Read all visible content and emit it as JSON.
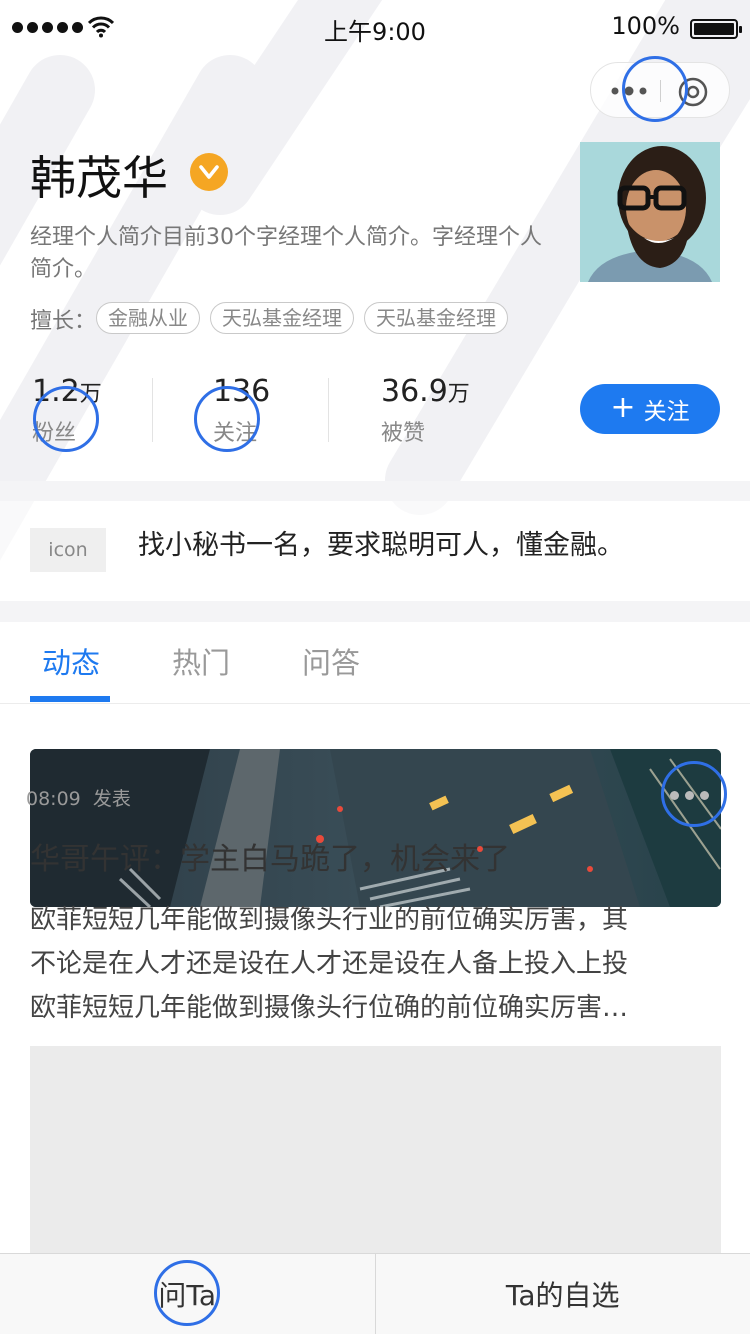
{
  "status_bar": {
    "time": "上午9:00",
    "battery": "100%"
  },
  "profile": {
    "name": "韩茂华",
    "intro": "经理个人简介目前30个字经理个人简介。字经理个人简介。",
    "skills_label": "擅长：",
    "skills": [
      "金融从业",
      "天弘基金经理",
      "天弘基金经理"
    ]
  },
  "stats": [
    {
      "value": "1.2",
      "unit": "万",
      "label": "粉丝"
    },
    {
      "value": "136",
      "unit": "",
      "label": "关注"
    },
    {
      "value": "36.9",
      "unit": "万",
      "label": "被赞"
    }
  ],
  "follow_button": {
    "plus": "+",
    "label": "关注"
  },
  "notice": {
    "icon_label": "icon",
    "text": "找小秘书一名，要求聪明可人，懂金融。"
  },
  "tabs": [
    {
      "label": "动态",
      "active": true
    },
    {
      "label": "热门",
      "active": false
    },
    {
      "label": "问答",
      "active": false
    }
  ],
  "post": {
    "time": "08:09",
    "action": "发表",
    "title": "华哥午评：学主白马跪了，机会来了",
    "body_lines": [
      "欧菲短短几年能做到摄像头行业的前位确实厉害，其",
      "不论是在人才还是设在人才还是设在人备上投入上投",
      "欧菲短短几年能做到摄像头行位确的前位确实厉害…"
    ]
  },
  "bottom_bar": {
    "ask": "问Ta",
    "watchlist": "Ta的自选"
  },
  "colors": {
    "accent": "#1e7af0",
    "verified": "#f5a623",
    "tap_ring": "#2f6fe6"
  },
  "icons": [
    "wifi-icon",
    "battery-icon",
    "more-dots-icon",
    "close-circle-icon",
    "verified-v-icon",
    "plus-icon"
  ]
}
